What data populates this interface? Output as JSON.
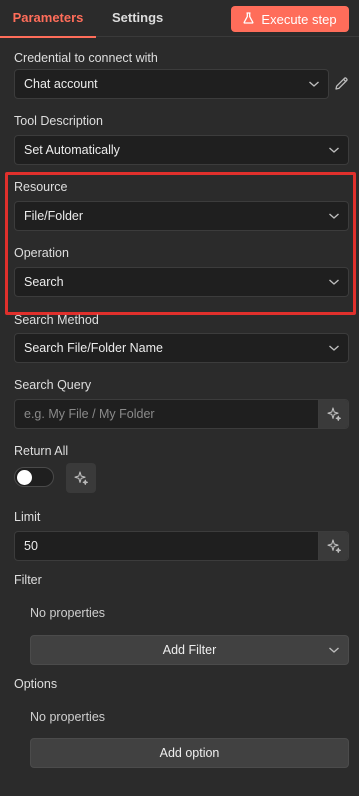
{
  "header": {
    "tabs": [
      {
        "label": "Parameters"
      },
      {
        "label": "Settings"
      }
    ],
    "execute_label": "Execute step"
  },
  "fields": {
    "credential": {
      "label": "Credential to connect with",
      "value": "Chat account"
    },
    "tool_description": {
      "label": "Tool Description",
      "value": "Set Automatically"
    },
    "resource": {
      "label": "Resource",
      "value": "File/Folder"
    },
    "operation": {
      "label": "Operation",
      "value": "Search"
    },
    "search_method": {
      "label": "Search Method",
      "value": "Search File/Folder Name"
    },
    "search_query": {
      "label": "Search Query",
      "placeholder": "e.g. My File / My Folder",
      "value": ""
    },
    "return_all": {
      "label": "Return All",
      "enabled": false
    },
    "limit": {
      "label": "Limit",
      "value": "50"
    }
  },
  "filter": {
    "label": "Filter",
    "empty_text": "No properties",
    "add_label": "Add Filter"
  },
  "options": {
    "label": "Options",
    "empty_text": "No properties",
    "add_label": "Add option"
  },
  "colors": {
    "accent": "#ff6d5a",
    "highlight": "#e0302c",
    "background": "#2b2b2b",
    "input_bg": "#1f1f1f"
  }
}
